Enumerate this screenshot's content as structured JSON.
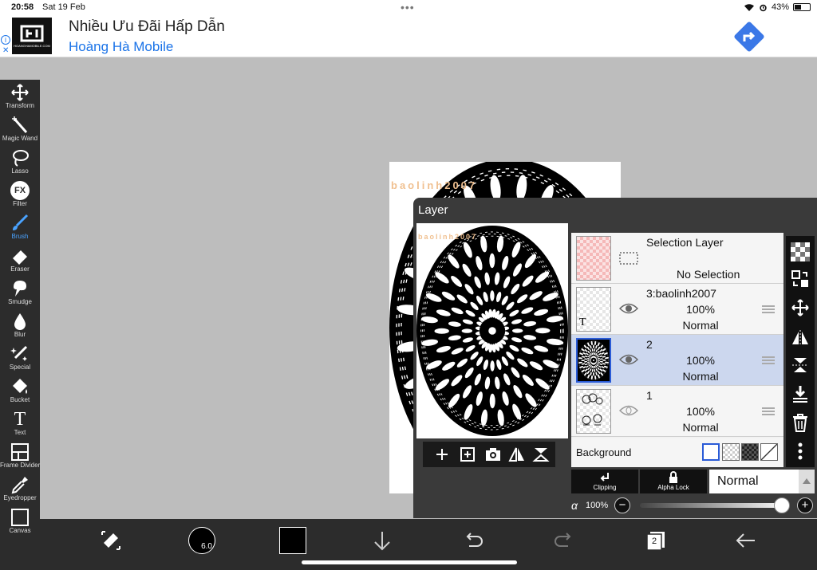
{
  "status": {
    "time": "20:58",
    "date": "Sat 19 Feb",
    "battery": "43%",
    "battery_level": 0.43
  },
  "ad": {
    "title": "Nhiều Ưu Đãi Hấp Dẫn",
    "advertiser": "Hoàng Hà Mobile",
    "logo_text": "HOANGHAMOBILE.COM",
    "info_glyph": "i",
    "close_glyph": "✕"
  },
  "toolbar": {
    "items": [
      {
        "label": "Transform",
        "icon": "move-icon"
      },
      {
        "label": "Magic Wand",
        "icon": "magic-wand-icon"
      },
      {
        "label": "Lasso",
        "icon": "lasso-icon"
      },
      {
        "label": "Filter",
        "icon": "fx-icon",
        "glyph": "FX"
      },
      {
        "label": "Brush",
        "icon": "brush-icon",
        "active": true
      },
      {
        "label": "Eraser",
        "icon": "eraser-icon"
      },
      {
        "label": "Smudge",
        "icon": "smudge-icon"
      },
      {
        "label": "Blur",
        "icon": "blur-icon"
      },
      {
        "label": "Special",
        "icon": "special-icon"
      },
      {
        "label": "Bucket",
        "icon": "bucket-icon"
      },
      {
        "label": "Text",
        "icon": "text-icon",
        "glyph": "T"
      },
      {
        "label": "Frame Divider",
        "icon": "frame-divider-icon"
      },
      {
        "label": "Eyedropper",
        "icon": "eyedropper-icon"
      },
      {
        "label": "Canvas",
        "icon": "canvas-icon"
      }
    ]
  },
  "bottom_bar": {
    "brush_size": "6.0",
    "layer_count": "2",
    "color": "#000000"
  },
  "canvas": {
    "watermark_text": "baolinh2007",
    "watermark_color": "#f0c090"
  },
  "layer_panel": {
    "title": "Layer",
    "layers": [
      {
        "name": "Selection Layer",
        "subtext": "No Selection",
        "kind": "selection"
      },
      {
        "name": "3:baolinh2007",
        "opacity": "100%",
        "blend": "Normal",
        "kind": "text",
        "thumb_glyph": "T"
      },
      {
        "name": "2",
        "opacity": "100%",
        "blend": "Normal",
        "kind": "mandala",
        "selected": true
      },
      {
        "name": "1",
        "opacity": "100%",
        "blend": "Normal",
        "kind": "sketch"
      }
    ],
    "background_label": "Background",
    "clipping_label": "Clipping",
    "alpha_lock_label": "Alpha Lock",
    "blend_mode": "Normal",
    "alpha_symbol": "α",
    "opacity_value": "100%",
    "minus": "−",
    "plus": "+",
    "accent": "#2a5bd7"
  }
}
